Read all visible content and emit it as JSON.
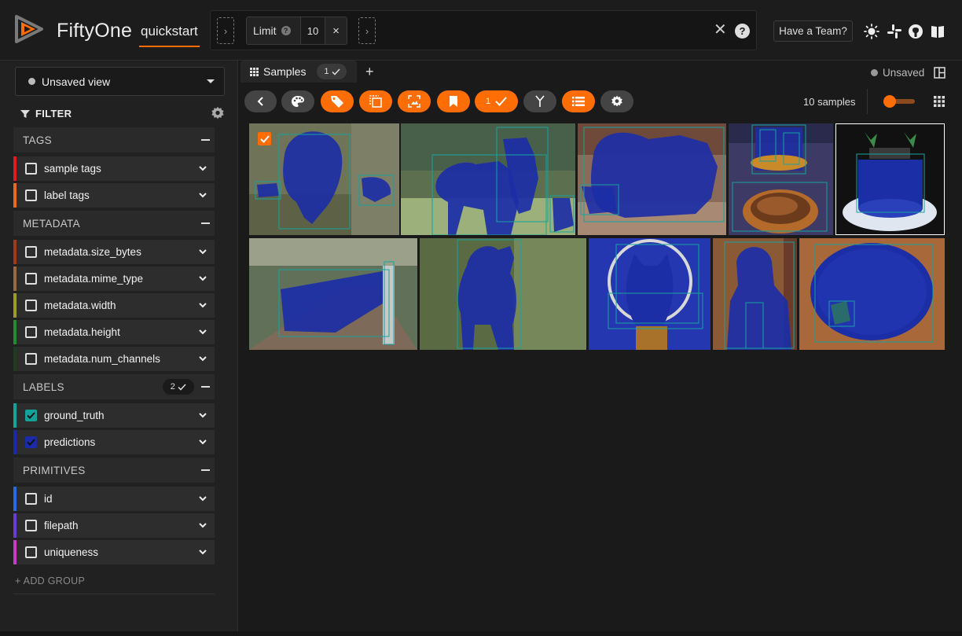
{
  "app": {
    "name": "FiftyOne",
    "dataset": "quickstart"
  },
  "view_bar": {
    "stage_name": "Limit",
    "stage_value": "10",
    "help_glyph": "?"
  },
  "header": {
    "team_button": "Have a Team?"
  },
  "sidebar": {
    "view_select": "Unsaved view",
    "filter_label": "FILTER",
    "groups": {
      "tags": "TAGS",
      "metadata": "METADATA",
      "labels": "LABELS",
      "labels_badge": "2",
      "primitives": "PRIMITIVES"
    },
    "fields": {
      "sample_tags": "sample tags",
      "label_tags": "label tags",
      "size_bytes": "metadata.size_bytes",
      "mime_type": "metadata.mime_type",
      "width": "metadata.width",
      "height": "metadata.height",
      "num_channels": "metadata.num_channels",
      "ground_truth": "ground_truth",
      "predictions": "predictions",
      "id": "id",
      "filepath": "filepath",
      "uniqueness": "uniqueness"
    },
    "field_colors": {
      "sample_tags": "#e31b1b",
      "label_tags": "#e86a1c",
      "size_bytes": "#a03a17",
      "mime_type": "#9a6a3a",
      "width": "#9e9a2c",
      "height": "#1f8f2a",
      "num_channels": "#1d3d1e",
      "ground_truth": "#13a39b",
      "predictions": "#1a2aa8",
      "id": "#1f6fe0",
      "filepath": "#6b3bd6",
      "uniqueness": "#c83bc8"
    },
    "add_group": "+ ADD GROUP"
  },
  "main": {
    "tab_label": "Samples",
    "tab_badge": "1",
    "unsaved_label": "Unsaved",
    "selected_badge": "1",
    "samples_count": "10 samples"
  },
  "colors": {
    "accent": "#ff6d04",
    "overlay": "#1c2ea6",
    "box_gt": "#16a3a0"
  },
  "icons": [
    "dataset-logo",
    "chevron-right-icon",
    "help-icon",
    "close-icon",
    "sun-icon",
    "slack-icon",
    "github-icon",
    "book-icon",
    "filter-icon",
    "gear-icon",
    "chevron-down-icon",
    "grid-icon",
    "plus-icon",
    "layout-icon",
    "back-icon",
    "palette-icon",
    "tag-icon",
    "tag-labels-icon",
    "patches-icon",
    "bookmark-icon",
    "check-icon",
    "merge-icon",
    "list-icon"
  ]
}
